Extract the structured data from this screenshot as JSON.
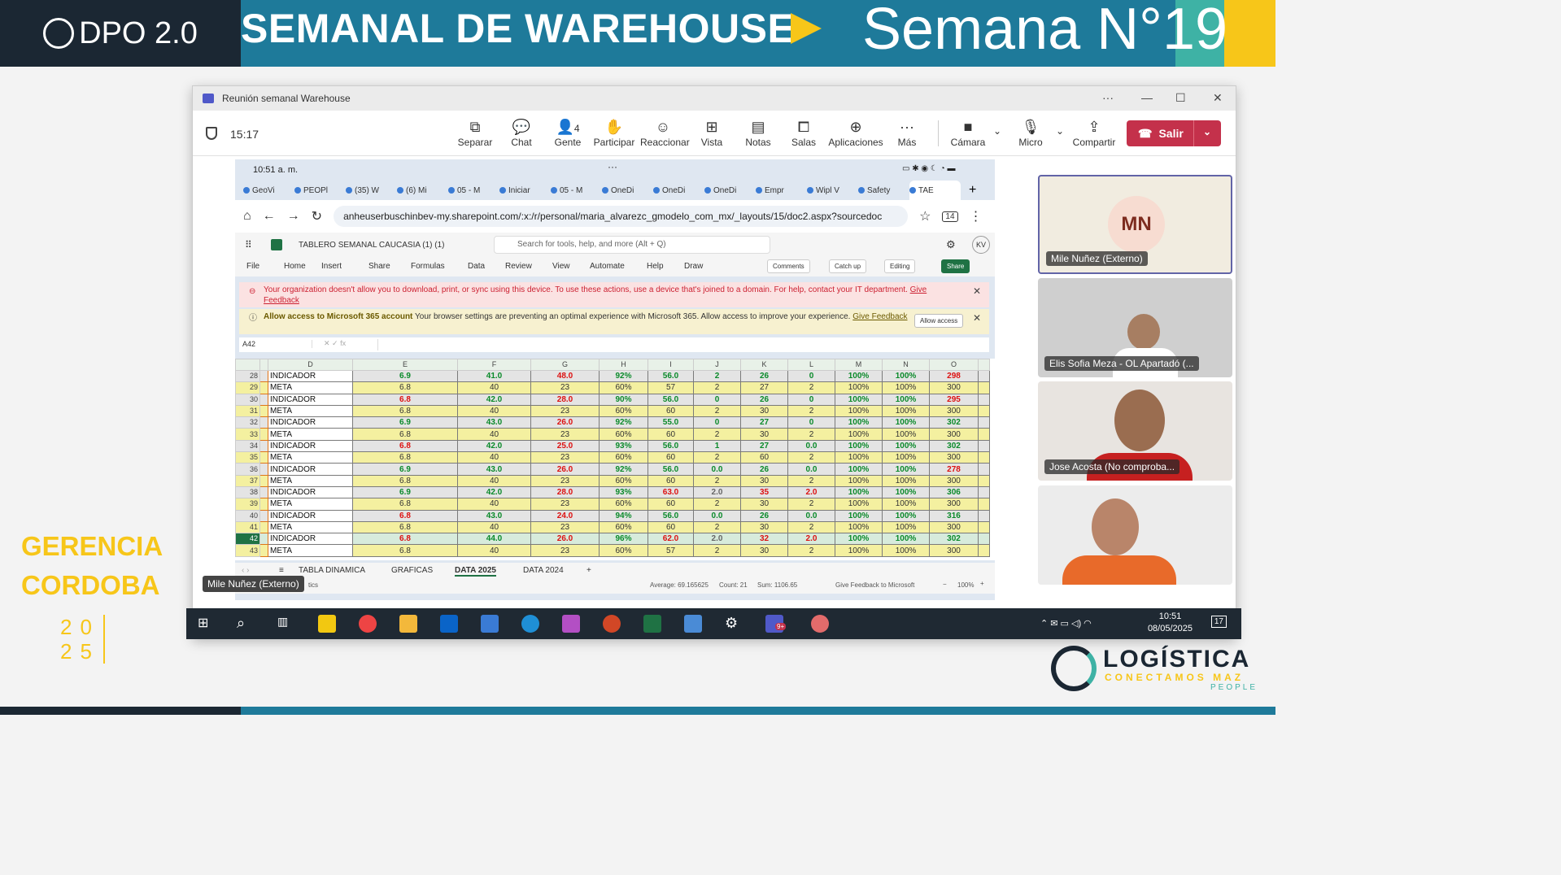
{
  "slide": {
    "logo": "DPO 2.0",
    "title": "SEMANAL DE WAREHOUSE",
    "week": "Semana N°19",
    "gerencia_line1": "GERENCIA",
    "gerencia_line2": "CORDOBA",
    "year_top": "20",
    "year_bottom": "25",
    "brand": "LOGÍSTICA",
    "brand_sub": "CONECTAMOS MAZ",
    "brand_sub2": "PEOPLE"
  },
  "teams": {
    "window_title": "Reunión semanal Warehouse",
    "time": "15:17",
    "toolbar": {
      "separar": "Separar",
      "chat": "Chat",
      "gente": "Gente",
      "gente_count": "4",
      "participar": "Participar",
      "reaccionar": "Reaccionar",
      "vista": "Vista",
      "notas": "Notas",
      "salas": "Salas",
      "aplicaciones": "Aplicaciones",
      "mas": "Más",
      "camara": "Cámara",
      "micro": "Micro",
      "compartir": "Compartir",
      "salir": "Salir"
    },
    "participants": [
      {
        "name": "Mile Nuñez (Externo)",
        "initials": "MN"
      },
      {
        "name": "Elis Sofia Meza - OL Apartadó (..."
      },
      {
        "name": "Jose Acosta (No comproba..."
      },
      {
        "name": ""
      }
    ],
    "presenter_tag": "Mile Nuñez (Externo)"
  },
  "browser": {
    "phone_time": "10:51 a. m.",
    "tabs": [
      "GeoVi",
      "PEOPl",
      "(35) W",
      "(6) Mi",
      "05 - M",
      "Iniciar",
      "05 - M",
      "OneDi",
      "OneDi",
      "OneDi",
      "Empr",
      "Wipl V",
      "Safety",
      "TAE"
    ],
    "url": "anheuserbuschinbev-my.sharepoint.com/:x:/r/personal/maria_alvarezc_gmodelo_com_mx/_layouts/15/doc2.aspx?sourcedoc",
    "tab_count": "14"
  },
  "excel": {
    "file_title": "TABLERO SEMANAL CAUCASIA (1) (1)",
    "search_placeholder": "Search for tools, help, and more (Alt + Q)",
    "user_initials": "KV",
    "menu": [
      "File",
      "Home",
      "Insert",
      "Share",
      "Formulas",
      "Data",
      "Review",
      "View",
      "Automate",
      "Help",
      "Draw"
    ],
    "btn_comments": "Comments",
    "btn_catchup": "Catch up",
    "btn_editing": "Editing",
    "btn_share": "Share",
    "msg1": "Your organization doesn't allow you to download, print, or sync using this device. To use these actions, use a device that's joined to a domain. For help, contact your IT department.",
    "msg1_link": "Give Feedback",
    "msg2_bold": "Allow access to Microsoft 365 account",
    "msg2": "Your browser settings are preventing an optimal experience with Microsoft 365. Allow access to improve your experience.",
    "msg2_link": "Give Feedback",
    "allow_access": "Allow access",
    "cell_ref": "A42",
    "columns": [
      "D",
      "E",
      "F",
      "G",
      "H",
      "I",
      "J",
      "K",
      "L",
      "M",
      "N",
      "O"
    ],
    "rows": [
      {
        "n": "28",
        "label": "INDICADOR",
        "v": [
          "6.9",
          "41.0",
          "48.0",
          "92%",
          "56.0",
          "2",
          "26",
          "0",
          "100%",
          "100%",
          "298"
        ],
        "c": [
          "g",
          "g",
          "r",
          "g",
          "g",
          "g",
          "g",
          "g",
          "g",
          "g",
          "r"
        ]
      },
      {
        "n": "29",
        "label": "META",
        "v": [
          "6.8",
          "40",
          "23",
          "60%",
          "57",
          "2",
          "27",
          "2",
          "100%",
          "100%",
          "300"
        ]
      },
      {
        "n": "30",
        "label": "INDICADOR",
        "v": [
          "6.8",
          "42.0",
          "28.0",
          "90%",
          "56.0",
          "0",
          "26",
          "0",
          "100%",
          "100%",
          "295"
        ],
        "c": [
          "r",
          "g",
          "r",
          "g",
          "g",
          "g",
          "g",
          "g",
          "g",
          "g",
          "r"
        ]
      },
      {
        "n": "31",
        "label": "META",
        "v": [
          "6.8",
          "40",
          "23",
          "60%",
          "60",
          "2",
          "30",
          "2",
          "100%",
          "100%",
          "300"
        ]
      },
      {
        "n": "32",
        "label": "INDICADOR",
        "v": [
          "6.9",
          "43.0",
          "26.0",
          "92%",
          "55.0",
          "0",
          "27",
          "0",
          "100%",
          "100%",
          "302"
        ],
        "c": [
          "g",
          "g",
          "r",
          "g",
          "g",
          "g",
          "g",
          "g",
          "g",
          "g",
          "g"
        ]
      },
      {
        "n": "33",
        "label": "META",
        "v": [
          "6.8",
          "40",
          "23",
          "60%",
          "60",
          "2",
          "30",
          "2",
          "100%",
          "100%",
          "300"
        ]
      },
      {
        "n": "34",
        "label": "INDICADOR",
        "v": [
          "6.8",
          "42.0",
          "25.0",
          "93%",
          "56.0",
          "1",
          "27",
          "0.0",
          "100%",
          "100%",
          "302"
        ],
        "c": [
          "r",
          "g",
          "r",
          "g",
          "g",
          "g",
          "g",
          "g",
          "g",
          "g",
          "g"
        ]
      },
      {
        "n": "35",
        "label": "META",
        "v": [
          "6.8",
          "40",
          "23",
          "60%",
          "60",
          "2",
          "60",
          "2",
          "100%",
          "100%",
          "300"
        ]
      },
      {
        "n": "36",
        "label": "INDICADOR",
        "v": [
          "6.9",
          "43.0",
          "26.0",
          "92%",
          "56.0",
          "0.0",
          "26",
          "0.0",
          "100%",
          "100%",
          "278"
        ],
        "c": [
          "g",
          "g",
          "r",
          "g",
          "g",
          "g",
          "g",
          "g",
          "g",
          "g",
          "r"
        ]
      },
      {
        "n": "37",
        "label": "META",
        "v": [
          "6.8",
          "40",
          "23",
          "60%",
          "60",
          "2",
          "30",
          "2",
          "100%",
          "100%",
          "300"
        ]
      },
      {
        "n": "38",
        "label": "INDICADOR",
        "v": [
          "6.9",
          "42.0",
          "28.0",
          "93%",
          "63.0",
          "2.0",
          "35",
          "2.0",
          "100%",
          "100%",
          "306"
        ],
        "c": [
          "g",
          "g",
          "r",
          "g",
          "r",
          "gy",
          "r",
          "r",
          "g",
          "g",
          "g"
        ]
      },
      {
        "n": "39",
        "label": "META",
        "v": [
          "6.8",
          "40",
          "23",
          "60%",
          "60",
          "2",
          "30",
          "2",
          "100%",
          "100%",
          "300"
        ]
      },
      {
        "n": "40",
        "label": "INDICADOR",
        "v": [
          "6.8",
          "43.0",
          "24.0",
          "94%",
          "56.0",
          "0.0",
          "26",
          "0.0",
          "100%",
          "100%",
          "316"
        ],
        "c": [
          "r",
          "g",
          "r",
          "g",
          "g",
          "g",
          "g",
          "g",
          "g",
          "g",
          "g"
        ]
      },
      {
        "n": "41",
        "label": "META",
        "v": [
          "6.8",
          "40",
          "23",
          "60%",
          "60",
          "2",
          "30",
          "2",
          "100%",
          "100%",
          "300"
        ]
      },
      {
        "n": "42",
        "label": "INDICADOR",
        "v": [
          "6.8",
          "44.0",
          "26.0",
          "96%",
          "62.0",
          "2.0",
          "32",
          "2.0",
          "100%",
          "100%",
          "302"
        ],
        "c": [
          "r",
          "g",
          "r",
          "g",
          "r",
          "gy",
          "r",
          "r",
          "g",
          "g",
          "g"
        ],
        "selected": true
      },
      {
        "n": "43",
        "label": "META",
        "v": [
          "6.8",
          "40",
          "23",
          "60%",
          "57",
          "2",
          "30",
          "2",
          "100%",
          "100%",
          "300"
        ]
      }
    ],
    "sheets": [
      "TABLA DINAMICA",
      "GRAFICAS",
      "DATA 2025",
      "DATA 2024"
    ],
    "active_sheet": "DATA 2025",
    "status_average": "Average: 69.165625",
    "status_count": "Count: 21",
    "status_sum": "Sum: 1106.65",
    "status_feedback": "Give Feedback to Microsoft",
    "zoom": "100%",
    "partial_tab": "tics"
  },
  "taskbar": {
    "time": "10:51",
    "date": "08/05/2025",
    "teams_badge": "9+",
    "notif": "17"
  }
}
